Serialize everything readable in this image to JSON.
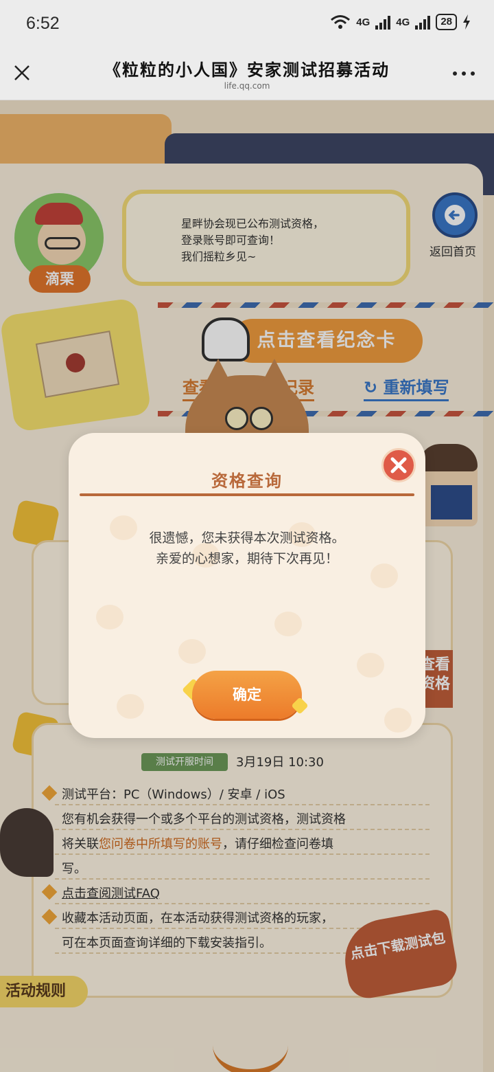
{
  "status_bar": {
    "time": "6:52",
    "network1": "4G",
    "network2": "4G",
    "battery": "28"
  },
  "title_bar": {
    "title": "《粒粒的小人国》安家测试招募活动",
    "domain": "life.qq.com"
  },
  "npc": {
    "name": "滴栗",
    "bubble_lines": [
      "星畔协会现已公布测试资格，",
      "登录账号即可查询！",
      "我们摇粒乡见~"
    ]
  },
  "back_home": {
    "label": "返回首页"
  },
  "actions": {
    "souvenir_card": "点击查看纪念卡",
    "view_record": "查看问卷填写记录",
    "refill": "重新填写"
  },
  "side_tab": {
    "label": "查看资格"
  },
  "test_info": {
    "open_time_tag": "测试开服时间",
    "open_time": "3月19日 10:30",
    "platform": "测试平台：PC（Windows）/ 安卓 / iOS",
    "desc_line1": "您有机会获得一个或多个平台的测试资格，测试资格",
    "desc_line2_prefix": "将关联",
    "desc_line2_highlight": "您问卷中所填写的账号",
    "desc_line2_suffix": "，请仔细检查问卷填",
    "desc_line3": "写。",
    "faq_link": "点击查阅测试FAQ",
    "collect_line1": "收藏本活动页面，在本活动获得测试资格的玩家，",
    "collect_line2": "可在本页面查询详细的下载安装指引。"
  },
  "download": {
    "label": "点击下载测试包"
  },
  "rules_tab": {
    "label": "活动规则"
  },
  "modal": {
    "title": "资格查询",
    "message_line1": "很遗憾，您未获得本次测试资格。",
    "message_line2": "亲爱的心想家，期待下次再见！",
    "confirm_label": "确定"
  },
  "colors": {
    "accent_orange": "#ec7b2a",
    "title_brown": "#b8683a",
    "link_blue": "#3a78c9",
    "close_red": "#df5b48"
  },
  "icons": [
    "close-icon",
    "more-icon",
    "wifi-icon",
    "signal-icon",
    "battery-icon",
    "charging-icon",
    "back-arrow-icon",
    "refresh-icon",
    "pointing-hand-icon",
    "envelope-icon",
    "modal-close-icon"
  ]
}
